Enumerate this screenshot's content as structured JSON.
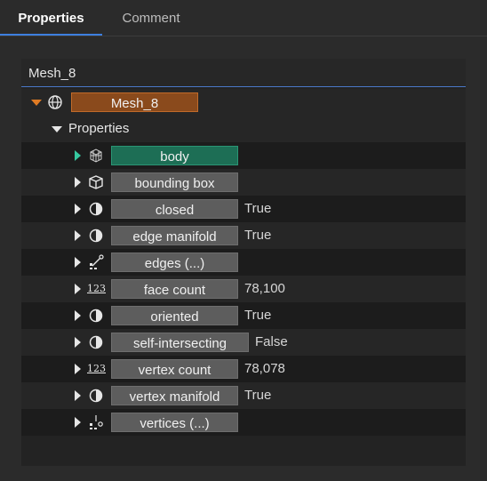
{
  "tabs": [
    "Properties",
    "Comment"
  ],
  "panel_title": "Mesh_8",
  "root": {
    "label": "Mesh_8",
    "icon": "globe-icon"
  },
  "group": {
    "label": "Properties"
  },
  "items": [
    {
      "label": "body",
      "value": "",
      "icon": "mesh-icon"
    },
    {
      "label": "bounding box",
      "value": "",
      "icon": "cube-icon"
    },
    {
      "label": "closed",
      "value": "True",
      "icon": "half-circle-icon"
    },
    {
      "label": "edge manifold",
      "value": "True",
      "icon": "half-circle-icon"
    },
    {
      "label": "edges (...)",
      "value": "",
      "icon": "edges-icon"
    },
    {
      "label": "face count",
      "value": "78,100",
      "icon": "number-icon"
    },
    {
      "label": "oriented",
      "value": "True",
      "icon": "half-circle-icon"
    },
    {
      "label": "self-intersecting",
      "value": "False",
      "icon": "half-circle-icon"
    },
    {
      "label": "vertex count",
      "value": "78,078",
      "icon": "number-icon"
    },
    {
      "label": "vertex manifold",
      "value": "True",
      "icon": "half-circle-icon"
    },
    {
      "label": "vertices (...)",
      "value": "",
      "icon": "vertices-icon"
    }
  ],
  "number_icon_text": "123",
  "colors": {
    "accent": "#3d7fe0",
    "mesh": "#8a4a1c",
    "body": "#1d6e55",
    "body_arrow": "#36c9a0"
  }
}
